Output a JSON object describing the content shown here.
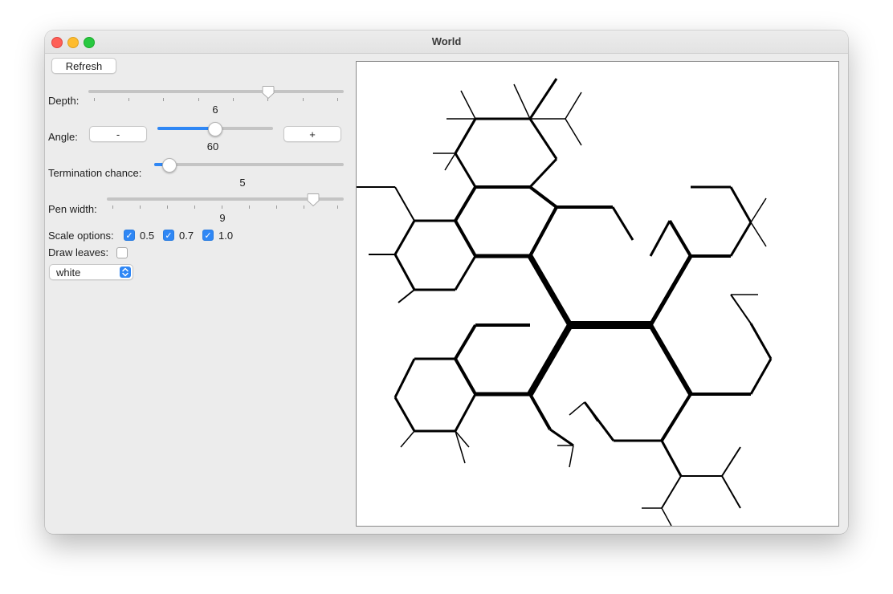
{
  "window": {
    "title": "World"
  },
  "controls": {
    "refresh_label": "Refresh",
    "depth": {
      "label": "Depth:",
      "value": "6",
      "fraction": 0.7
    },
    "angle": {
      "label": "Angle:",
      "minus_label": "-",
      "plus_label": "+",
      "value": "60",
      "fraction": 0.5
    },
    "termination": {
      "label": "Termination chance:",
      "value": "5",
      "fraction": 0.08
    },
    "pen_width": {
      "label": "Pen width:",
      "value": "9",
      "fraction": 0.88
    },
    "scale": {
      "label": "Scale options:",
      "options": [
        {
          "label": "0.5",
          "checked": true
        },
        {
          "label": "0.7",
          "checked": true
        },
        {
          "label": "1.0",
          "checked": true
        }
      ]
    },
    "draw_leaves": {
      "label": "Draw leaves:",
      "checked": false
    },
    "color_select": {
      "value": "white"
    }
  },
  "colors": {
    "accent": "#2f87f5",
    "stroke": "#000000",
    "canvas_bg": "#ffffff"
  }
}
